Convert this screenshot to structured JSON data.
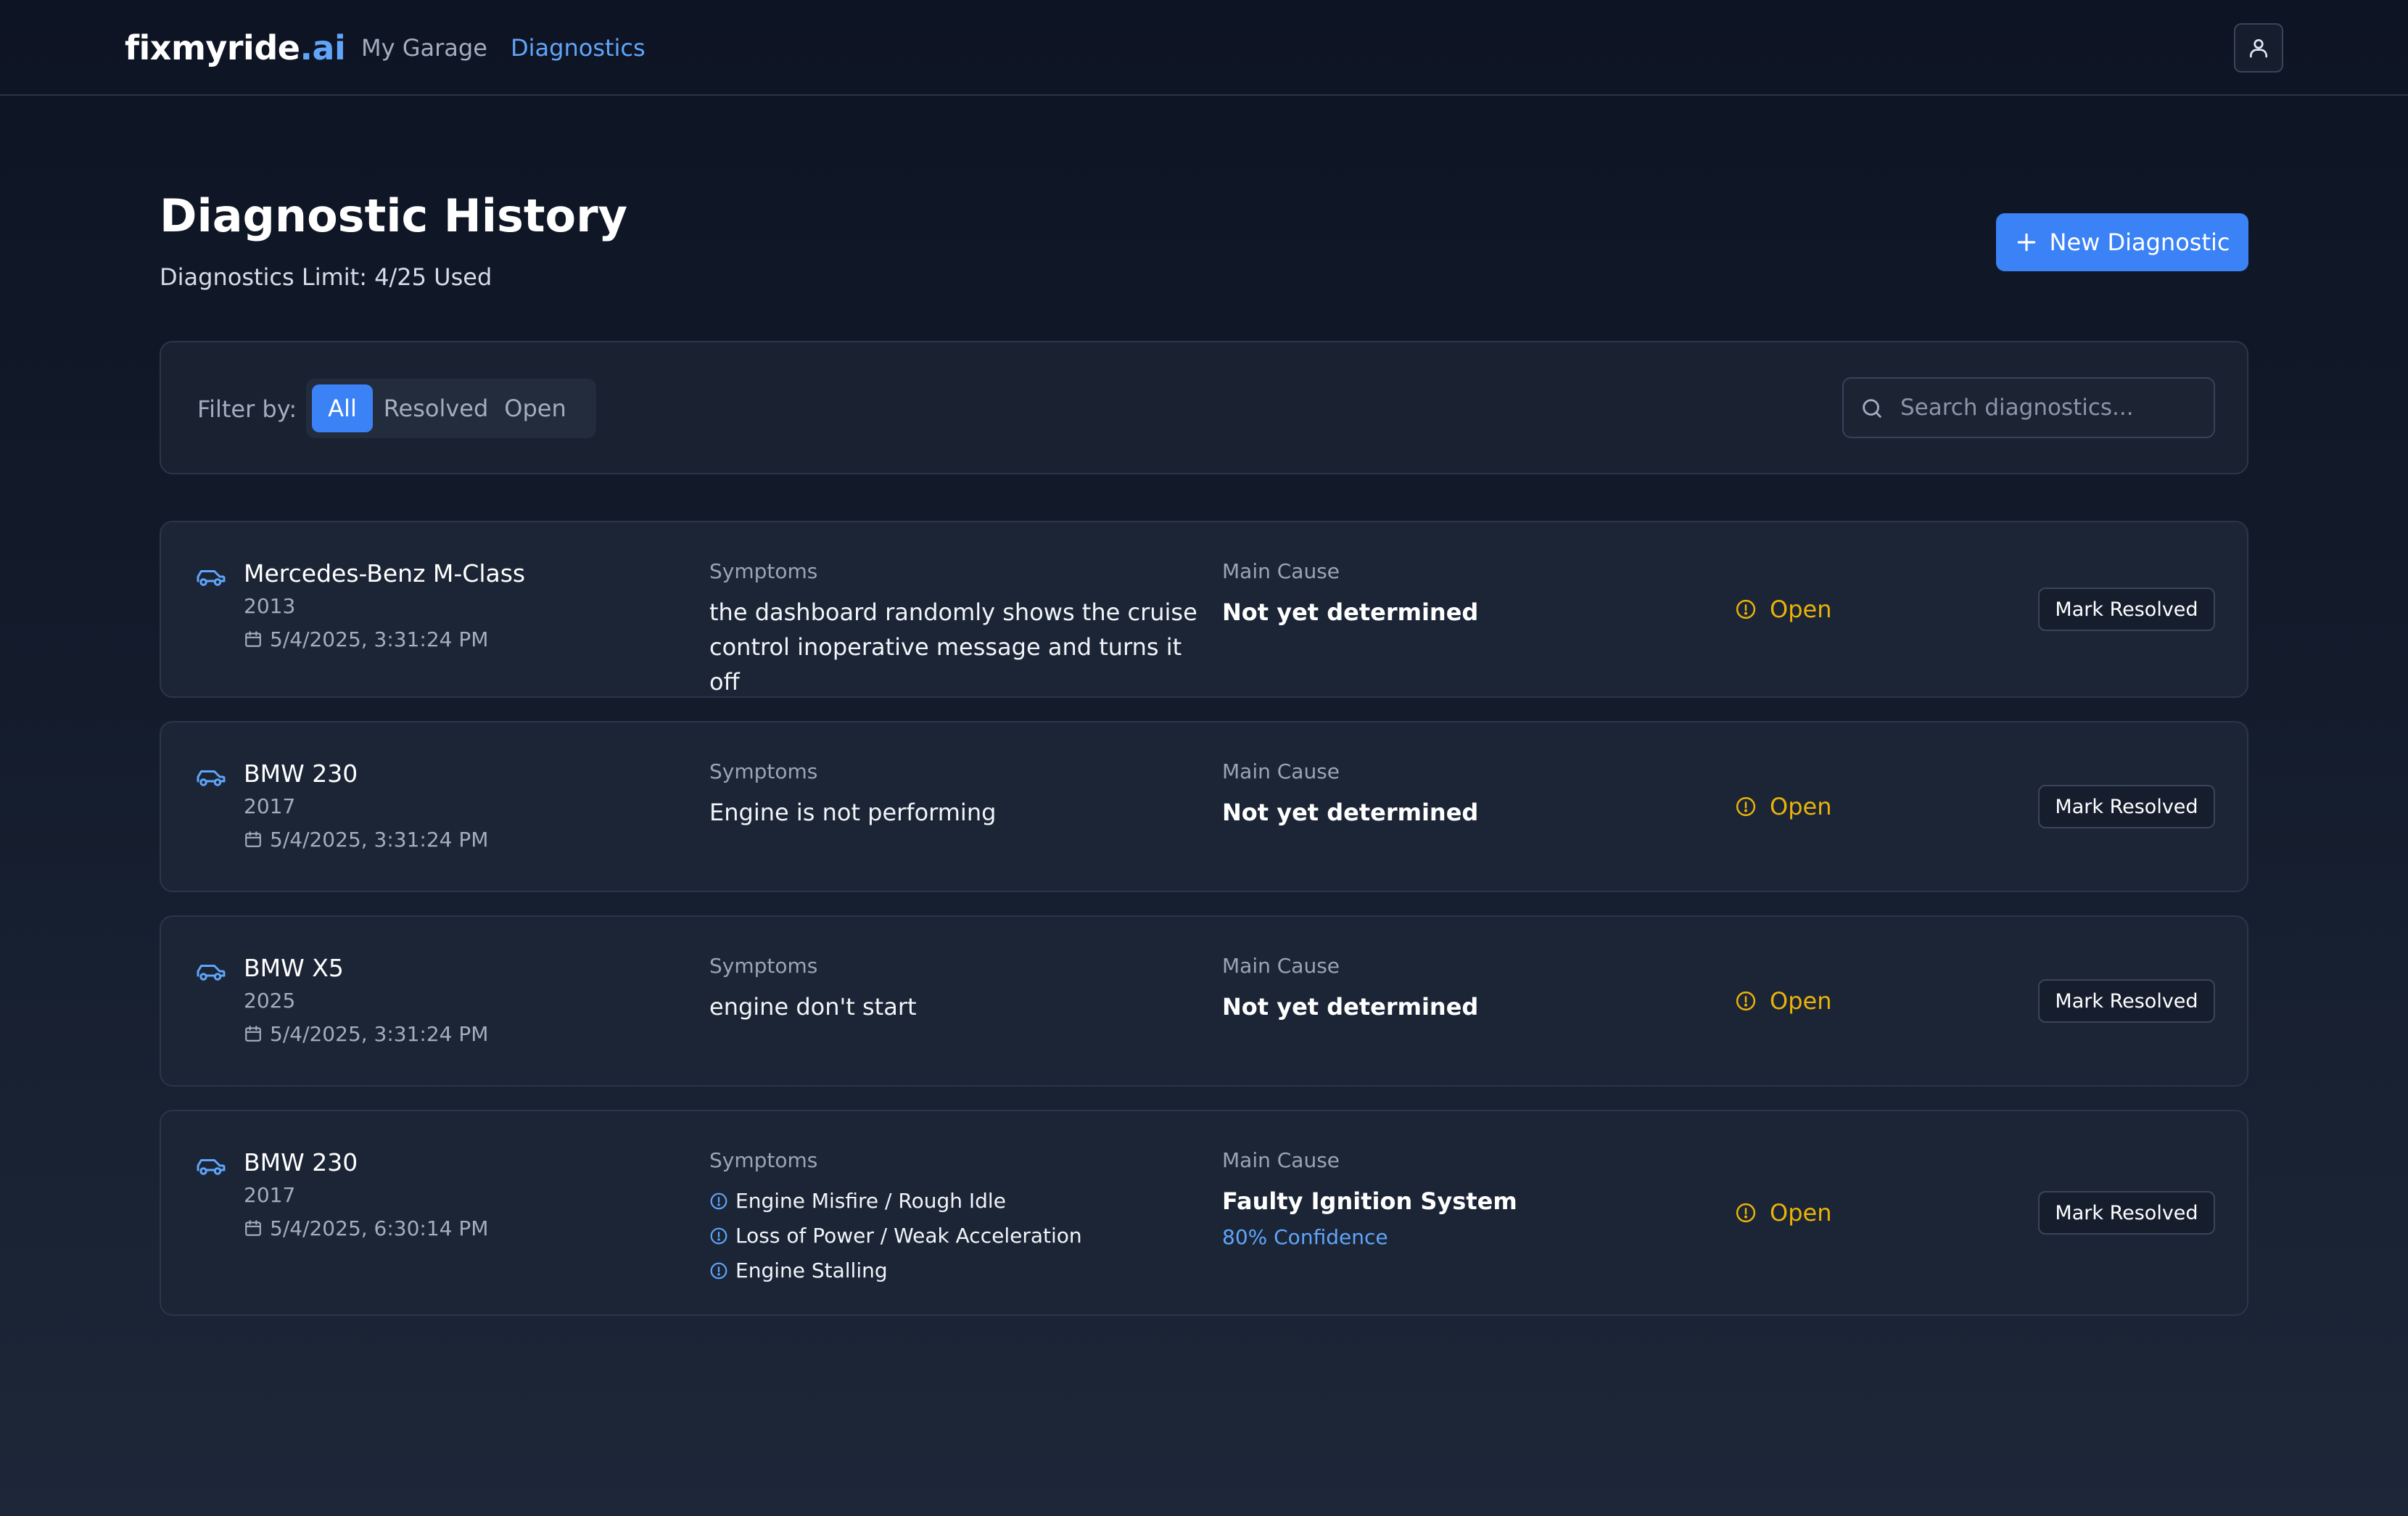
{
  "header": {
    "logo_main": "fixmyride",
    "logo_accent": ".ai",
    "nav": [
      {
        "label": "My Garage",
        "active": false
      },
      {
        "label": "Diagnostics",
        "active": true
      }
    ],
    "user_icon": "user-icon"
  },
  "page": {
    "title": "Diagnostic History",
    "limit_text": "Diagnostics Limit: 4/25 Used",
    "new_button_label": "New Diagnostic"
  },
  "filters": {
    "label": "Filter by:",
    "options": [
      "All",
      "Resolved",
      "Open"
    ],
    "selected": "All",
    "search_placeholder": "Search diagnostics...",
    "search_value": ""
  },
  "columns": {
    "symptoms": "Symptoms",
    "main_cause": "Main Cause"
  },
  "diagnostics": [
    {
      "vehicle": "Mercedes-Benz M-Class",
      "year": "2013",
      "date": "5/4/2025, 3:31:24 PM",
      "symptoms_text": "the dashboard randomly shows the cruise control inoperative message and turns it off",
      "main_cause": "Not yet determined",
      "status": "Open",
      "action_label": "Mark Resolved"
    },
    {
      "vehicle": "BMW 230",
      "year": "2017",
      "date": "5/4/2025, 3:31:24 PM",
      "symptoms_text": "Engine is not performing",
      "main_cause": "Not yet determined",
      "status": "Open",
      "action_label": "Mark Resolved"
    },
    {
      "vehicle": "BMW X5",
      "year": "2025",
      "date": "5/4/2025, 3:31:24 PM",
      "symptoms_text": "engine don't start",
      "main_cause": "Not yet determined",
      "status": "Open",
      "action_label": "Mark Resolved"
    },
    {
      "vehicle": "BMW 230",
      "year": "2017",
      "date": "5/4/2025, 6:30:14 PM",
      "symptoms_list": [
        "Engine Misfire / Rough Idle",
        "Loss of Power / Weak Acceleration",
        "Engine Stalling"
      ],
      "main_cause": "Faulty Ignition System",
      "confidence": "80% Confidence",
      "status": "Open",
      "action_label": "Mark Resolved"
    }
  ],
  "colors": {
    "accent": "#3b82f6",
    "accent_text": "#60a5fa",
    "status_open": "#eab308",
    "card_bg": "#1c2536"
  }
}
